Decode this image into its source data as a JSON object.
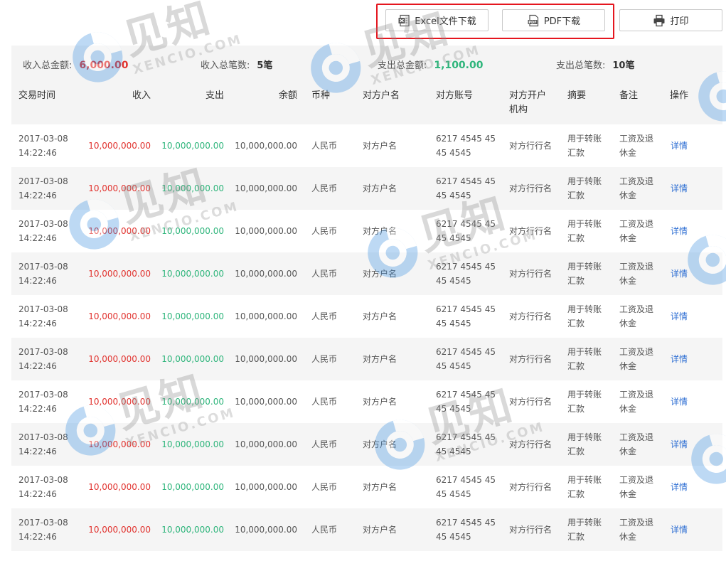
{
  "toolbar": {
    "excel_label": "Excel文件下载",
    "pdf_label": "PDF下载",
    "print_label": "打印"
  },
  "summary": {
    "income_total_label": "收入总金额:",
    "income_total_value": "6,000.00",
    "income_count_label": "收入总笔数:",
    "income_count_value": "5笔",
    "expense_total_label": "支出总金额:",
    "expense_total_value": "1,100.00",
    "expense_count_label": "支出总笔数:",
    "expense_count_value": "10笔"
  },
  "table": {
    "headers": {
      "time": "交易时间",
      "income": "收入",
      "expense": "支出",
      "balance": "余额",
      "currency": "币种",
      "payee_name": "对方户名",
      "payee_account": "对方账号",
      "payee_bank_1": "对方开户",
      "payee_bank_2": "机构",
      "summary": "摘要",
      "remark": "备注",
      "action": "操作"
    },
    "rows": [
      {
        "date": "2017-03-08",
        "time": "14:22:46",
        "income": "10,000,000.00",
        "expense": "10,000,000.00",
        "balance": "10,000,000.00",
        "currency": "人民币",
        "payee_name": "对方户名",
        "account_1": "6217 4545 45",
        "account_2": "45 4545",
        "bank": "对方行行名",
        "summary_1": "用于转账",
        "summary_2": "汇款",
        "remark_1": "工资及退",
        "remark_2": "休金",
        "action": "详情"
      },
      {
        "date": "2017-03-08",
        "time": "14:22:46",
        "income": "10,000,000.00",
        "expense": "10,000,000.00",
        "balance": "10,000,000.00",
        "currency": "人民币",
        "payee_name": "对方户名",
        "account_1": "6217 4545 45",
        "account_2": "45 4545",
        "bank": "对方行行名",
        "summary_1": "用于转账",
        "summary_2": "汇款",
        "remark_1": "工资及退",
        "remark_2": "休金",
        "action": "详情"
      },
      {
        "date": "2017-03-08",
        "time": "14:22:46",
        "income": "10,000,000.00",
        "expense": "10,000,000.00",
        "balance": "10,000,000.00",
        "currency": "人民币",
        "payee_name": "对方户名",
        "account_1": "6217 4545 45",
        "account_2": "45 4545",
        "bank": "对方行行名",
        "summary_1": "用于转账",
        "summary_2": "汇款",
        "remark_1": "工资及退",
        "remark_2": "休金",
        "action": "详情"
      },
      {
        "date": "2017-03-08",
        "time": "14:22:46",
        "income": "10,000,000.00",
        "expense": "10,000,000.00",
        "balance": "10,000,000.00",
        "currency": "人民币",
        "payee_name": "对方户名",
        "account_1": "6217 4545 45",
        "account_2": "45 4545",
        "bank": "对方行行名",
        "summary_1": "用于转账",
        "summary_2": "汇款",
        "remark_1": "工资及退",
        "remark_2": "休金",
        "action": "详情"
      },
      {
        "date": "2017-03-08",
        "time": "14:22:46",
        "income": "10,000,000.00",
        "expense": "10,000,000.00",
        "balance": "10,000,000.00",
        "currency": "人民币",
        "payee_name": "对方户名",
        "account_1": "6217 4545 45",
        "account_2": "45 4545",
        "bank": "对方行行名",
        "summary_1": "用于转账",
        "summary_2": "汇款",
        "remark_1": "工资及退",
        "remark_2": "休金",
        "action": "详情"
      },
      {
        "date": "2017-03-08",
        "time": "14:22:46",
        "income": "10,000,000.00",
        "expense": "10,000,000.00",
        "balance": "10,000,000.00",
        "currency": "人民币",
        "payee_name": "对方户名",
        "account_1": "6217 4545 45",
        "account_2": "45 4545",
        "bank": "对方行行名",
        "summary_1": "用于转账",
        "summary_2": "汇款",
        "remark_1": "工资及退",
        "remark_2": "休金",
        "action": "详情"
      },
      {
        "date": "2017-03-08",
        "time": "14:22:46",
        "income": "10,000,000.00",
        "expense": "10,000,000.00",
        "balance": "10,000,000.00",
        "currency": "人民币",
        "payee_name": "对方户名",
        "account_1": "6217 4545 45",
        "account_2": "45 4545",
        "bank": "对方行行名",
        "summary_1": "用于转账",
        "summary_2": "汇款",
        "remark_1": "工资及退",
        "remark_2": "休金",
        "action": "详情"
      },
      {
        "date": "2017-03-08",
        "time": "14:22:46",
        "income": "10,000,000.00",
        "expense": "10,000,000.00",
        "balance": "10,000,000.00",
        "currency": "人民币",
        "payee_name": "对方户名",
        "account_1": "6217 4545 45",
        "account_2": "45 4545",
        "bank": "对方行行名",
        "summary_1": "用于转账",
        "summary_2": "汇款",
        "remark_1": "工资及退",
        "remark_2": "休金",
        "action": "详情"
      },
      {
        "date": "2017-03-08",
        "time": "14:22:46",
        "income": "10,000,000.00",
        "expense": "10,000,000.00",
        "balance": "10,000,000.00",
        "currency": "人民币",
        "payee_name": "对方户名",
        "account_1": "6217 4545 45",
        "account_2": "45 4545",
        "bank": "对方行行名",
        "summary_1": "用于转账",
        "summary_2": "汇款",
        "remark_1": "工资及退",
        "remark_2": "休金",
        "action": "详情"
      },
      {
        "date": "2017-03-08",
        "time": "14:22:46",
        "income": "10,000,000.00",
        "expense": "10,000,000.00",
        "balance": "10,000,000.00",
        "currency": "人民币",
        "payee_name": "对方户名",
        "account_1": "6217 4545 45",
        "account_2": "45 4545",
        "bank": "对方行行名",
        "summary_1": "用于转账",
        "summary_2": "汇款",
        "remark_1": "工资及退",
        "remark_2": "休金",
        "action": "详情"
      }
    ]
  },
  "watermark": {
    "cn": "见知",
    "en": "XENCIO.COM"
  },
  "colors": {
    "income": "#e1332f",
    "expense": "#2eb57b",
    "link": "#2d6ed3",
    "highlight": "#e5161f",
    "watermark_logo": "#3a8fe0"
  }
}
